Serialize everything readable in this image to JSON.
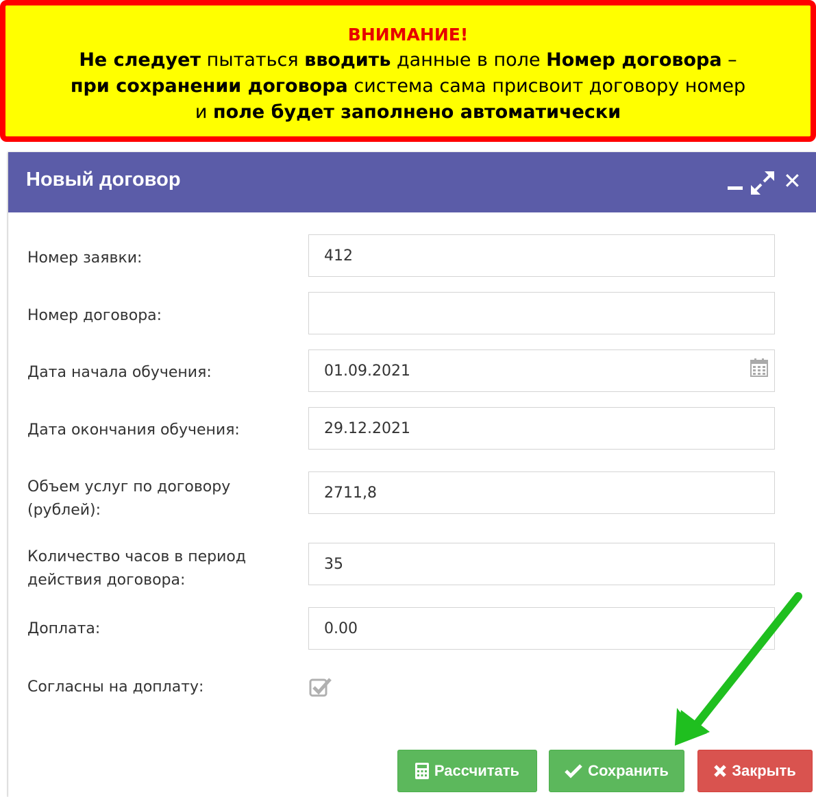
{
  "warning": {
    "title": "ВНИМАНИЕ!",
    "l1_b1": "Не следует",
    "l1_t1": " пытаться ",
    "l1_b2": "вводить",
    "l1_t2": " данные в поле ",
    "l1_b3": "Номер договора",
    "l1_t3": " –",
    "l2_b1": "при сохранении договора",
    "l2_t1": " система сама присвоит договору номер",
    "l3_t1": "и ",
    "l3_b1": "поле будет заполнено автоматически"
  },
  "dialog": {
    "title": "Новый договор"
  },
  "form": {
    "request_number_label": "Номер заявки:",
    "request_number_value": "412",
    "contract_number_label": "Номер договора:",
    "contract_number_value": "",
    "start_date_label": "Дата начала обучения:",
    "start_date_value": "01.09.2021",
    "end_date_label": "Дата окончания обучения:",
    "end_date_value": "29.12.2021",
    "services_volume_label_1": "Объем услуг по договору",
    "services_volume_label_2": "(рублей):",
    "services_volume_value": "2711,8",
    "hours_label_1": "Количество часов в период",
    "hours_label_2": "действия договора:",
    "hours_value": "35",
    "surcharge_label": "Доплата:",
    "surcharge_value": "0.00",
    "agree_label": "Согласны на доплату:",
    "agree_checked": true
  },
  "buttons": {
    "calculate": "Рассчитать",
    "save": "Сохранить",
    "close": "Закрыть"
  },
  "colors": {
    "header": "#5b5ca8",
    "warning_bg": "#ffff00",
    "warning_border": "#ff0000",
    "save_green": "#5cb85c",
    "close_red": "#d9534f",
    "arrow_green": "#22c022"
  }
}
